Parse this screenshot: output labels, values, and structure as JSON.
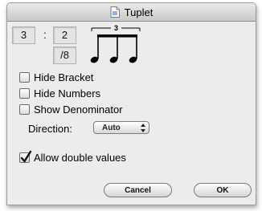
{
  "window": {
    "title": "Tuplet",
    "title_icon": "document-icon"
  },
  "ratio": {
    "numerator": "3",
    "separator": ":",
    "denominator": "2",
    "unit": "/8"
  },
  "preview": {
    "bracket_number": "3",
    "notes": 3
  },
  "options": [
    {
      "label": "Hide Bracket",
      "checked": false
    },
    {
      "label": "Hide Numbers",
      "checked": false
    },
    {
      "label": "Show Denominator",
      "checked": false
    }
  ],
  "direction": {
    "label": "Direction:",
    "value": "Auto"
  },
  "allow_double": {
    "label": "Allow double values",
    "checked": true
  },
  "buttons": {
    "cancel": "Cancel",
    "ok": "OK"
  }
}
